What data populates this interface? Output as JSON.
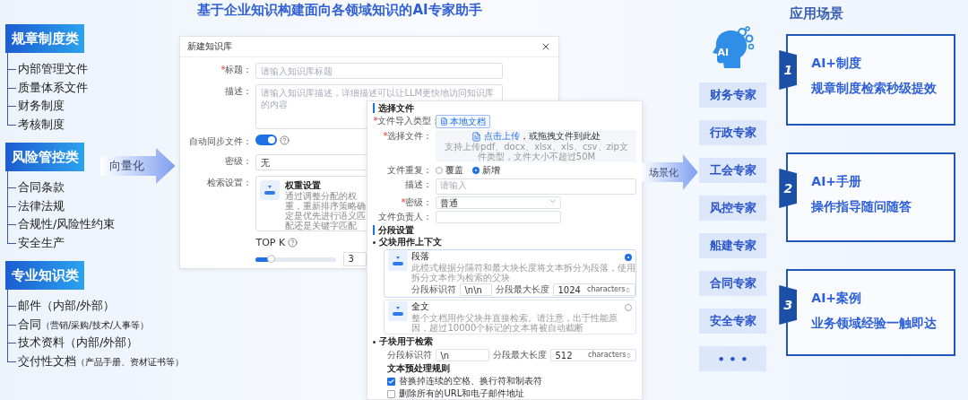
{
  "title": "基于企业知识构建面向各领域知识的AI专家助手",
  "categories": [
    {
      "title": "规章制度类",
      "items": [
        {
          "label": "内部管理文件"
        },
        {
          "label": "质量体系文件"
        },
        {
          "label": "财务制度"
        },
        {
          "label": "考核制度"
        }
      ]
    },
    {
      "title": "风险管控类",
      "items": [
        {
          "label": "合同条款"
        },
        {
          "label": "法律法规"
        },
        {
          "label": "合规性/风险性约束"
        },
        {
          "label": "安全生产"
        }
      ]
    },
    {
      "title": "专业知识类",
      "items": [
        {
          "label": "邮件（内部/外部）"
        },
        {
          "label": "合同",
          "note": "（营销/采购/技术/人事等）"
        },
        {
          "label": "技术资料（内部/外部）"
        },
        {
          "label": "交付性文档",
          "note": "（产品手册、资材证书等）"
        }
      ]
    }
  ],
  "vectorize_arrow": {
    "label": "向量化"
  },
  "kb_dialog": {
    "title": "新建知识库",
    "title_field": {
      "required": "*",
      "label": "标题：",
      "placeholder": "请输入知识库标题"
    },
    "description_field": {
      "label": "描述：",
      "placeholder": "请输入知识库描述，详细描述可以让LLM更快地访问知识库的内容"
    },
    "auto_sync": {
      "label": "自动同步文件：",
      "on": true
    },
    "security_level": {
      "label": "密级：",
      "value": "无"
    },
    "retrieval": {
      "label": "检索设置：",
      "option_title": "权重设置",
      "option_description": "通过调整分配的权重，重新排序策略确定是优先进行语义匹配还是关键字匹配"
    },
    "top_k": {
      "label": "TOP K",
      "level": 0.2,
      "value": "3"
    }
  },
  "upload_dialog": {
    "file_section": {
      "title": "选择文件"
    },
    "import_type": {
      "required": "*",
      "label": "文件导入类型：",
      "button": "本地文档"
    },
    "file_select": {
      "required": "*",
      "label": "选择文件：",
      "action": "点击上传",
      "hint": "，或拖拽文件到此处",
      "support": "支持上传pdf、docx、xlsx、xls、csv、zip文件类型，文件大小不超过50M"
    },
    "duplicate": {
      "label": "文件重复：",
      "options": [
        {
          "label": "覆盖",
          "selected": false
        },
        {
          "label": "新增",
          "selected": true
        }
      ]
    },
    "description": {
      "label": "描述：",
      "placeholder": "请输入"
    },
    "security": {
      "required": "*",
      "label": "密级：",
      "value": "普通"
    },
    "owner": {
      "label": "文件负责人："
    },
    "segment_section": {
      "title": "分段设置"
    },
    "parent_chunk": {
      "title": "父块用作上下文",
      "modes": [
        {
          "title": "段落",
          "description": "此模式根据分隔符和最大块长度将文本拆分为段落，使用拆分文本作为检索的父块",
          "selected": true,
          "separator_label": "分段标识符",
          "separator": "\\n\\n",
          "max_length_label": "分段最大长度",
          "max_length": "1024",
          "unit": "characters"
        },
        {
          "title": "全文",
          "description": "整个文档用作父块并直接检索。请注意，出于性能原因，超过10000个标记的文本将被自动截断",
          "selected": false
        }
      ]
    },
    "child_chunk": {
      "title": "子块用于检索",
      "separator_label": "分段标识符",
      "separator": "\\n",
      "max_length_label": "分段最大长度",
      "max_length": "512",
      "unit": "characters"
    },
    "preprocess": {
      "title": "文本预处理规则",
      "rules": [
        {
          "label": "替换掉连续的空格、换行符和制表符",
          "checked": true
        },
        {
          "label": "删除所有的URL和电子邮件地址",
          "checked": false
        }
      ]
    }
  },
  "scene_arrow": {
    "label": "场景化"
  },
  "ai_badge": {
    "label": "AI"
  },
  "experts": [
    {
      "label": "财务专家"
    },
    {
      "label": "行政专家"
    },
    {
      "label": "工会专家"
    },
    {
      "label": "风控专家"
    },
    {
      "label": "船建专家"
    },
    {
      "label": "合同专家"
    },
    {
      "label": "安全专家"
    },
    {
      "label": "• • •"
    }
  ],
  "scenarios": {
    "title": "应用场景",
    "items": [
      {
        "number": "1",
        "title": "AI+制度",
        "subtitle": "规章制度检索秒级提效"
      },
      {
        "number": "2",
        "title": "AI+手册",
        "subtitle": "操作指导随问随答"
      },
      {
        "number": "3",
        "title": "AI+案例",
        "subtitle": "业务领域经验一触即达"
      }
    ]
  }
}
